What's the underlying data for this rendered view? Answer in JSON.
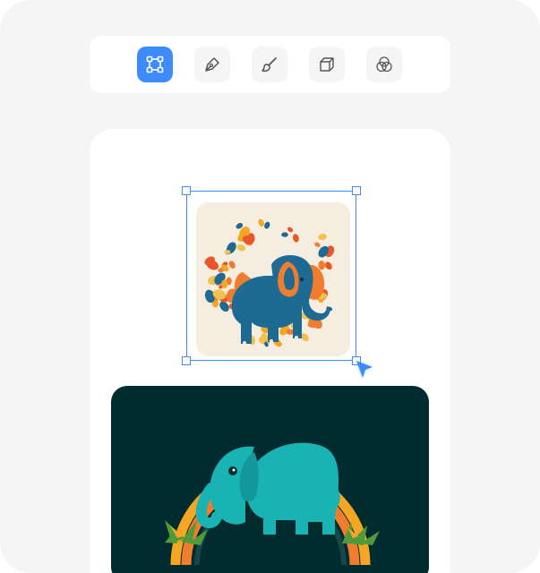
{
  "toolbar": {
    "tools": [
      {
        "icon": "transform-select-icon",
        "active": true
      },
      {
        "icon": "pen-tool-icon",
        "active": false
      },
      {
        "icon": "brush-icon",
        "active": false
      },
      {
        "icon": "cube-3d-icon",
        "active": false
      },
      {
        "icon": "blend-circles-icon",
        "active": false
      }
    ]
  },
  "canvas": {
    "images": [
      {
        "subject": "elephant-with-confetti-circle",
        "selected": true
      },
      {
        "subject": "elephant-under-rainbow",
        "selected": false
      }
    ]
  },
  "colors": {
    "accent": "#3d8bfd",
    "background": "#f5f5f5",
    "panel": "#ffffff",
    "dark_tile": "#002b2f"
  }
}
